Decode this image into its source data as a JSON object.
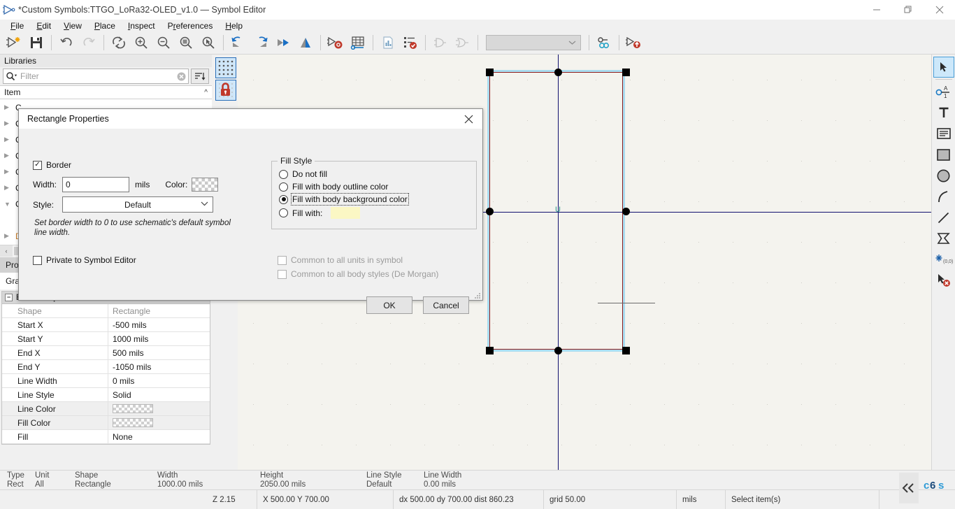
{
  "window": {
    "title": "*Custom Symbols:TTGO_LoRa32-OLED_v1.0 — Symbol Editor",
    "minimize": "—",
    "maximize": "❐",
    "close": "✕"
  },
  "menu": [
    "File",
    "Edit",
    "View",
    "Place",
    "Inspect",
    "Preferences",
    "Help"
  ],
  "toolbar": {
    "items": [
      "new-symbol-icon",
      "save-icon",
      "undo-icon",
      "redo-icon",
      "refresh-icon",
      "zoom-in-icon",
      "zoom-out-icon",
      "zoom-fit-icon",
      "zoom-selection-icon",
      "rotate-ccw-icon",
      "rotate-cw-icon",
      "mirror-horizontal-icon",
      "mirror-vertical-icon",
      "symbol-properties-icon",
      "pin-table-icon",
      "datasheet-icon",
      "erc-check-icon",
      "demorgan-normal-icon",
      "demorgan-alt-icon"
    ],
    "unit_selector_value": "",
    "tail_items": [
      "pin-link-icon",
      "export-symbol-icon"
    ]
  },
  "libraries": {
    "header": "Libraries",
    "filter_placeholder": "Filter",
    "clear_icon": "clear-icon",
    "sort_icon": "sort-icon",
    "column_header": "Item",
    "collapse_caret": "^",
    "tree_rows": [
      {
        "label": "C",
        "expanded": false,
        "orange": false
      },
      {
        "label": "C",
        "expanded": false,
        "orange": false
      },
      {
        "label": "C",
        "expanded": false,
        "orange": false
      },
      {
        "label": "C",
        "expanded": false,
        "orange": false
      },
      {
        "label": "C",
        "expanded": false,
        "orange": false
      },
      {
        "label": "C",
        "expanded": false,
        "orange": false
      },
      {
        "label": "C",
        "expanded": true,
        "orange": false
      },
      {
        "label": "",
        "expanded": null,
        "orange": false
      },
      {
        "label": "D",
        "expanded": false,
        "orange": true
      }
    ]
  },
  "panel_tabs": {
    "properties": "Prop",
    "graphics": "Grap"
  },
  "properties": {
    "group_title": "Basic Properties",
    "rows": [
      {
        "key": "Shape",
        "value": "Rectangle",
        "type": "text",
        "dim": true
      },
      {
        "key": "Start X",
        "value": "-500 mils",
        "type": "text",
        "dim": false
      },
      {
        "key": "Start Y",
        "value": "1000 mils",
        "type": "text",
        "dim": false
      },
      {
        "key": "End X",
        "value": "500 mils",
        "type": "text",
        "dim": false
      },
      {
        "key": "End Y",
        "value": "-1050 mils",
        "type": "text",
        "dim": false
      },
      {
        "key": "Line Width",
        "value": "0 mils",
        "type": "text",
        "dim": false
      },
      {
        "key": "Line Style",
        "value": "Solid",
        "type": "text",
        "dim": false
      },
      {
        "key": "Line Color",
        "value": "",
        "type": "swatch",
        "dim": false
      },
      {
        "key": "Fill Color",
        "value": "",
        "type": "swatch",
        "dim": false
      },
      {
        "key": "Fill",
        "value": "None",
        "type": "text",
        "dim": false
      }
    ]
  },
  "dialog": {
    "title": "Rectangle Properties",
    "close_icon": "close-icon",
    "border_checkbox": {
      "label": "Border",
      "checked": true
    },
    "width": {
      "label": "Width:",
      "value": "0",
      "unit": "mils"
    },
    "color": {
      "label": "Color:",
      "swatch": "transparent-checker"
    },
    "style": {
      "label": "Style:",
      "value": "Default",
      "arrow": "chevron-down-icon"
    },
    "hint": "Set border width to 0 to use schematic's default symbol line width.",
    "private_checkbox": {
      "label": "Private to Symbol Editor",
      "checked": false
    },
    "fill_style": {
      "legend": "Fill Style",
      "options": [
        {
          "label": "Do not fill",
          "selected": false
        },
        {
          "label": "Fill with body outline color",
          "selected": false
        },
        {
          "label": "Fill with body background color",
          "selected": true,
          "focused": true
        },
        {
          "label": "Fill with:",
          "selected": false,
          "swatch": "#fbf7c4"
        }
      ]
    },
    "common_units": {
      "label": "Common to all units in symbol",
      "checked": false,
      "disabled": true
    },
    "common_styles": {
      "label": "Common to all body styles (De Morgan)",
      "checked": false,
      "disabled": true
    },
    "ok": "OK",
    "cancel": "Cancel"
  },
  "right_toolbar": {
    "tools": [
      {
        "name": "select-tool",
        "glyph": "➤",
        "active": true
      },
      {
        "name": "pin-tool",
        "glyph": "pin",
        "active": false
      },
      {
        "name": "text-tool",
        "glyph": "T",
        "active": false
      },
      {
        "name": "textbox-tool",
        "glyph": "textbox",
        "active": false
      },
      {
        "name": "rectangle-tool",
        "glyph": "rect",
        "active": false
      },
      {
        "name": "circle-tool",
        "glyph": "circle",
        "active": false
      },
      {
        "name": "arc-tool",
        "glyph": "arc",
        "active": false
      },
      {
        "name": "line-tool",
        "glyph": "line",
        "active": false
      },
      {
        "name": "polygon-tool",
        "glyph": "poly",
        "active": false
      },
      {
        "name": "anchor-tool",
        "glyph": "(0,0)",
        "active": false
      },
      {
        "name": "delete-tool",
        "glyph": "delete",
        "active": false
      }
    ]
  },
  "canvas": {
    "grid_icon": "grid-icon",
    "lock_icon": "lock-icon",
    "unit_label": "U"
  },
  "statusbar_fields": [
    {
      "label": "Type",
      "value": "Rect"
    },
    {
      "label": "Unit",
      "value": "All"
    },
    {
      "label": "Shape",
      "value": "Rectangle"
    },
    {
      "label": "Width",
      "value": "1000.00 mils"
    },
    {
      "label": "Height",
      "value": "2050.00 mils"
    },
    {
      "label": "Line Style",
      "value": "Default"
    },
    {
      "label": "Line Width",
      "value": "0.00 mils"
    }
  ],
  "statusbar_bottom": {
    "zoom": "Z 2.15",
    "coords": "X 500.00  Y 700.00",
    "delta": "dx 500.00  dy 700.00  dist 860.23",
    "grid": "grid 50.00",
    "units": "mils",
    "action": "Select item(s)",
    "collapse_icon": "collapse-chevrons-icon",
    "logo": "c6s"
  }
}
